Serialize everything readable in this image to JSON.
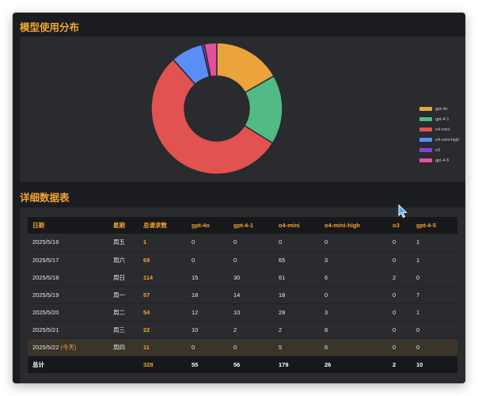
{
  "chart_section": {
    "title": "模型使用分布"
  },
  "table_section": {
    "title": "详细数据表"
  },
  "chart_data": {
    "type": "pie",
    "donut": true,
    "labels": [
      "gpt-4o",
      "gpt-4-1",
      "o4-mini",
      "o4-mini-high",
      "o3",
      "gpt-4-5"
    ],
    "values": [
      55,
      56,
      179,
      26,
      2,
      10
    ],
    "colors": [
      "#eba33b",
      "#52bb85",
      "#e05350",
      "#5a8ef6",
      "#8b3fe0",
      "#e54f9d"
    ],
    "legend_position": "right"
  },
  "table": {
    "headers": [
      "日期",
      "星期",
      "总请求数",
      "gpt-4o",
      "gpt-4-1",
      "o4-mini",
      "o4-mini-high",
      "o3",
      "gpt-4-5"
    ],
    "rows": [
      {
        "date": "2025/5/16",
        "today_tag": "",
        "weekday": "周五",
        "total": "1",
        "v": [
          "0",
          "0",
          "0",
          "0",
          "0",
          "1"
        ]
      },
      {
        "date": "2025/5/17",
        "today_tag": "",
        "weekday": "周六",
        "total": "69",
        "v": [
          "0",
          "0",
          "65",
          "3",
          "0",
          "1"
        ]
      },
      {
        "date": "2025/5/18",
        "today_tag": "",
        "weekday": "周日",
        "total": "114",
        "v": [
          "15",
          "30",
          "61",
          "6",
          "2",
          "0"
        ]
      },
      {
        "date": "2025/5/19",
        "today_tag": "",
        "weekday": "周一",
        "total": "57",
        "v": [
          "18",
          "14",
          "18",
          "0",
          "0",
          "7"
        ]
      },
      {
        "date": "2025/5/20",
        "today_tag": "",
        "weekday": "周二",
        "total": "54",
        "v": [
          "12",
          "10",
          "28",
          "3",
          "0",
          "1"
        ]
      },
      {
        "date": "2025/5/21",
        "today_tag": "",
        "weekday": "周三",
        "total": "22",
        "v": [
          "10",
          "2",
          "2",
          "8",
          "0",
          "0"
        ]
      },
      {
        "date": "2025/5/22",
        "today_tag": "(今天)",
        "weekday": "周四",
        "total": "11",
        "v": [
          "0",
          "0",
          "5",
          "6",
          "0",
          "0"
        ]
      }
    ],
    "footer": {
      "label": "总计",
      "weekday": "",
      "total": "328",
      "v": [
        "55",
        "56",
        "179",
        "26",
        "2",
        "10"
      ]
    }
  },
  "icons": {
    "cursor": "pointer-cursor-icon"
  }
}
